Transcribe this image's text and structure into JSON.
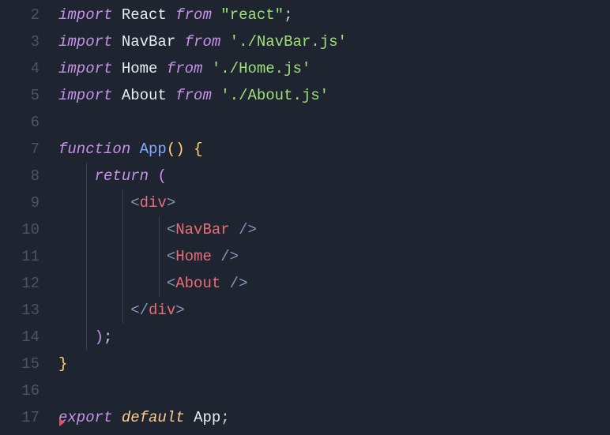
{
  "gutter": {
    "start": 2,
    "end": 17
  },
  "code": {
    "l2": {
      "import": "import",
      "react": "React",
      "from": "from",
      "str": "\"react\"",
      "semi": ";"
    },
    "l3": {
      "import": "import",
      "nav": "NavBar",
      "from": "from",
      "str": "'./NavBar.js'"
    },
    "l4": {
      "import": "import",
      "home": "Home",
      "from": "from",
      "str": "'./Home.js'"
    },
    "l5": {
      "import": "import",
      "about": "About",
      "from": "from",
      "str": "'./About.js'"
    },
    "l7": {
      "func": "function",
      "name": "App",
      "lp": "(",
      "rp": ")",
      "lb": "{"
    },
    "l8": {
      "ret": "return",
      "lp": "("
    },
    "l9": {
      "lt": "<",
      "name": "div",
      "gt": ">"
    },
    "l10": {
      "lt": "<",
      "name": "NavBar",
      "sl": "/",
      "gt": ">"
    },
    "l11": {
      "lt": "<",
      "name": "Home",
      "sl": "/",
      "gt": ">"
    },
    "l12": {
      "lt": "<",
      "name": "About",
      "sl": "/",
      "gt": ">"
    },
    "l13": {
      "lt": "<",
      "sl": "/",
      "name": "div",
      "gt": ">"
    },
    "l14": {
      "rp": ")",
      "semi": ";"
    },
    "l15": {
      "rb": "}"
    },
    "l17": {
      "exp": "export",
      "def": "default",
      "name": "App",
      "semi": ";"
    }
  }
}
